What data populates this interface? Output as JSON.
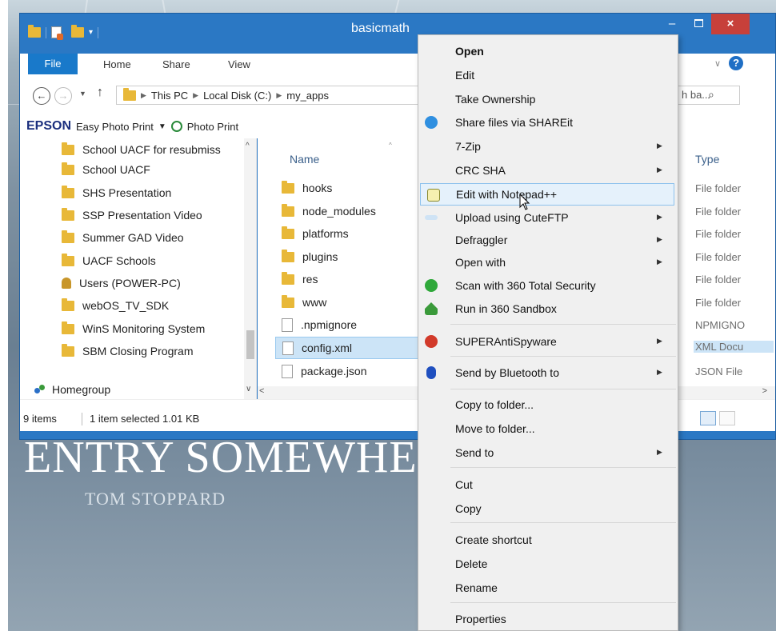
{
  "wallpaper": {
    "title_text": "ENTRY SOMEWHER",
    "author_text": "TOM STOPPARD"
  },
  "window": {
    "title": "basicmath",
    "buttons": {
      "minimize": "–",
      "close": "×"
    }
  },
  "ribbon": {
    "tabs": [
      "File",
      "Home",
      "Share",
      "View"
    ],
    "help": "?"
  },
  "address": {
    "path": [
      "This PC",
      "Local Disk (C:)",
      "my_apps"
    ],
    "search_placeholder": "h ba..."
  },
  "epson": {
    "brand": "EPSON",
    "easy_photo_print": "Easy Photo Print",
    "photo_print": "Photo Print"
  },
  "nav_pane": {
    "items": [
      {
        "label": "School UACF for resubmiss",
        "icon": "folder-icon"
      },
      {
        "label": "School UACF",
        "icon": "folder-icon"
      },
      {
        "label": "SHS Presentation",
        "icon": "folder-icon"
      },
      {
        "label": "SSP Presentation Video",
        "icon": "folder-icon"
      },
      {
        "label": "Summer GAD Video",
        "icon": "folder-icon"
      },
      {
        "label": "UACF Schools",
        "icon": "folder-icon"
      },
      {
        "label": "Users (POWER-PC)",
        "icon": "user-folder-icon"
      },
      {
        "label": "webOS_TV_SDK",
        "icon": "folder-icon"
      },
      {
        "label": "WinS Monitoring System",
        "icon": "folder-icon"
      },
      {
        "label": "SBM Closing Program",
        "icon": "folder-icon"
      }
    ],
    "homegroup": "Homegroup"
  },
  "file_list": {
    "columns": {
      "name": "Name",
      "type": "Type"
    },
    "rows": [
      {
        "name": "hooks",
        "type": "File folder",
        "icon": "folder-icon",
        "selected": false
      },
      {
        "name": "node_modules",
        "type": "File folder",
        "icon": "folder-icon",
        "selected": false
      },
      {
        "name": "platforms",
        "type": "File folder",
        "icon": "folder-icon",
        "selected": false
      },
      {
        "name": "plugins",
        "type": "File folder",
        "icon": "folder-icon",
        "selected": false
      },
      {
        "name": "res",
        "type": "File folder",
        "icon": "folder-icon",
        "selected": false
      },
      {
        "name": "www",
        "type": "File folder",
        "icon": "folder-icon",
        "selected": false
      },
      {
        "name": ".npmignore",
        "type": "NPMIGNO",
        "icon": "file-icon",
        "selected": false
      },
      {
        "name": "config.xml",
        "type": "XML Docu",
        "icon": "file-icon",
        "selected": true
      },
      {
        "name": "package.json",
        "type": "JSON File",
        "icon": "file-icon",
        "selected": false
      }
    ]
  },
  "status": {
    "items": "9 items",
    "selection": "1 item selected  1.01 KB"
  },
  "context_menu": {
    "items": [
      {
        "label": "Open",
        "bold": true,
        "icon": "",
        "submenu": false
      },
      {
        "label": "Edit",
        "icon": "",
        "submenu": false
      },
      {
        "label": "Take Ownership",
        "icon": "",
        "submenu": false
      },
      {
        "label": "Share files via SHAREit",
        "icon": "shareit-icon",
        "submenu": false
      },
      {
        "label": "7-Zip",
        "icon": "",
        "submenu": true
      },
      {
        "label": "CRC SHA",
        "icon": "",
        "submenu": true
      },
      {
        "label": "Edit with Notepad++",
        "icon": "notepadpp-icon",
        "submenu": false,
        "highlighted": true
      },
      {
        "label": "Upload using CuteFTP",
        "icon": "cuteftp-icon",
        "submenu": true
      },
      {
        "label": "Defraggler",
        "icon": "",
        "submenu": true
      },
      {
        "label": "Open with",
        "icon": "",
        "submenu": true
      },
      {
        "label": "Scan with 360 Total Security",
        "icon": "360-security-icon",
        "submenu": false
      },
      {
        "label": "Run in 360 Sandbox",
        "icon": "360-sandbox-icon",
        "submenu": false
      },
      {
        "label": "SUPERAntiSpyware",
        "icon": "superantispyware-icon",
        "submenu": true
      },
      {
        "label": "Send by Bluetooth to",
        "icon": "bluetooth-icon",
        "submenu": true
      },
      {
        "label": "Copy to folder...",
        "icon": "",
        "submenu": false
      },
      {
        "label": "Move to folder...",
        "icon": "",
        "submenu": false
      },
      {
        "label": "Send to",
        "icon": "",
        "submenu": true
      },
      {
        "label": "Cut",
        "icon": "",
        "submenu": false
      },
      {
        "label": "Copy",
        "icon": "",
        "submenu": false
      },
      {
        "label": "Create shortcut",
        "icon": "",
        "submenu": false
      },
      {
        "label": "Delete",
        "icon": "",
        "submenu": false
      },
      {
        "label": "Rename",
        "icon": "",
        "submenu": false
      },
      {
        "label": "Properties",
        "icon": "",
        "submenu": false
      }
    ]
  }
}
